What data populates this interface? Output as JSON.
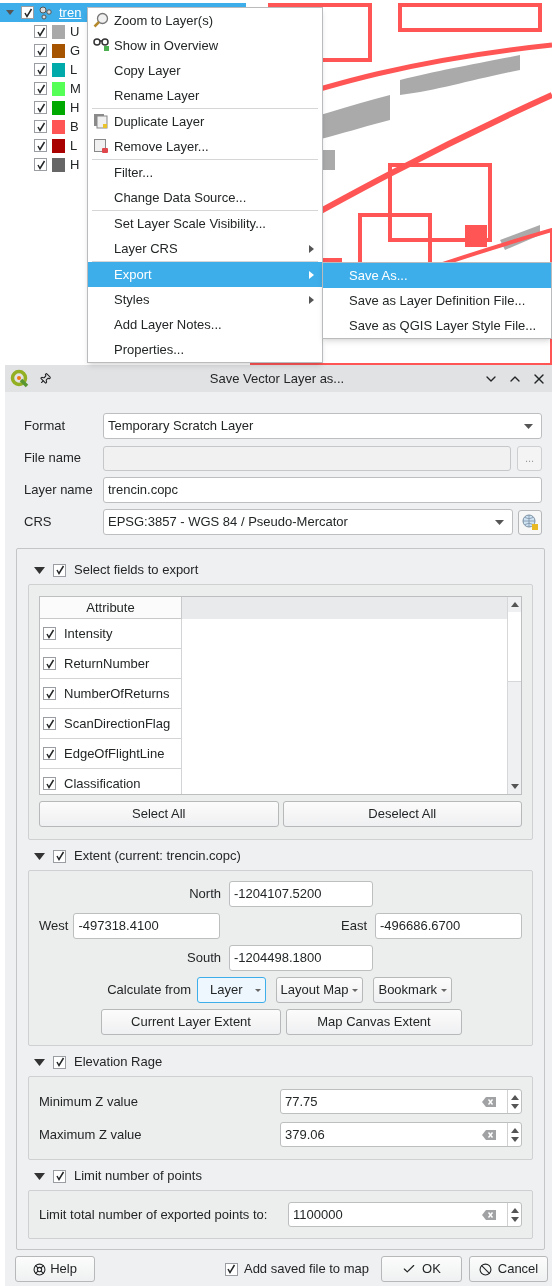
{
  "layer_tree": {
    "group": {
      "name": "tren",
      "checked": true,
      "expanded": true,
      "selected": true
    },
    "children": [
      {
        "label": "U",
        "checked": true,
        "color": "#a9a9a9"
      },
      {
        "label": "G",
        "checked": true,
        "color": "#a65400"
      },
      {
        "label": "L",
        "checked": true,
        "color": "#00a9aa"
      },
      {
        "label": "M",
        "checked": true,
        "color": "#55ff55"
      },
      {
        "label": "H",
        "checked": true,
        "color": "#00a900"
      },
      {
        "label": "B",
        "checked": true,
        "color": "#ff5555"
      },
      {
        "label": "L",
        "checked": true,
        "color": "#a90000"
      },
      {
        "label": "H",
        "checked": true,
        "color": "#666666"
      }
    ]
  },
  "context_menu": {
    "sections": [
      [
        {
          "label": "Zoom to Layer(s)",
          "selected": false,
          "submenu": false
        },
        {
          "label": "Show in Overview",
          "selected": false,
          "submenu": false
        },
        {
          "label": "Copy Layer",
          "selected": false,
          "submenu": false
        },
        {
          "label": "Rename Layer",
          "selected": false,
          "submenu": false
        }
      ],
      [
        {
          "label": "Duplicate Layer",
          "selected": false,
          "submenu": false
        },
        {
          "label": "Remove Layer...",
          "selected": false,
          "submenu": false
        }
      ],
      [
        {
          "label": "Filter...",
          "selected": false,
          "submenu": false
        },
        {
          "label": "Change Data Source...",
          "selected": false,
          "submenu": false
        }
      ],
      [
        {
          "label": "Set Layer Scale Visibility...",
          "selected": false,
          "submenu": false
        },
        {
          "label": "Layer CRS",
          "selected": false,
          "submenu": true
        }
      ],
      [
        {
          "label": "Export",
          "selected": true,
          "submenu": true
        },
        {
          "label": "Styles",
          "selected": false,
          "submenu": true
        },
        {
          "label": "Add Layer Notes...",
          "selected": false,
          "submenu": false
        },
        {
          "label": "Properties...",
          "selected": false,
          "submenu": false
        }
      ]
    ]
  },
  "submenu": {
    "items": [
      {
        "label": "Save As...",
        "selected": true
      },
      {
        "label": "Save as Layer Definition File...",
        "selected": false
      },
      {
        "label": "Save as QGIS Layer Style File...",
        "selected": false
      }
    ]
  },
  "dialog": {
    "title": "Save Vector Layer as...",
    "form": {
      "format": {
        "label": "Format",
        "value": "Temporary Scratch Layer"
      },
      "file_name": {
        "label": "File name",
        "disabled": true,
        "browse": "..."
      },
      "layer_name": {
        "label": "Layer name",
        "value": "trencin.copc"
      },
      "crs": {
        "label": "CRS",
        "value": "EPSG:3857 - WGS 84 / Pseudo-Mercator"
      }
    },
    "sections": [
      {
        "kind": "fields",
        "title": "Select fields to export",
        "checked": true,
        "expanded": true,
        "column": "Attribute",
        "rows": [
          {
            "label": "Intensity",
            "checked": true
          },
          {
            "label": "ReturnNumber",
            "checked": true
          },
          {
            "label": "NumberOfReturns",
            "checked": true
          },
          {
            "label": "ScanDirectionFlag",
            "checked": true
          },
          {
            "label": "EdgeOfFlightLine",
            "checked": true
          },
          {
            "label": "Classification",
            "checked": true
          }
        ],
        "buttons": [
          "Select All",
          "Deselect All"
        ]
      },
      {
        "kind": "extent",
        "title": "Extent (current: trencin.copc)",
        "checked": true,
        "expanded": true,
        "north": {
          "label": "North",
          "value": "-1204107.5200"
        },
        "west": {
          "label": "West",
          "value": "-497318.4100"
        },
        "east": {
          "label": "East",
          "value": "-496686.6700"
        },
        "south": {
          "label": "South",
          "value": "-1204498.1800"
        },
        "calculate_from": {
          "label": "Calculate from",
          "options": [
            {
              "label": "Layer",
              "focused": true
            },
            {
              "label": "Layout Map",
              "focused": false
            },
            {
              "label": "Bookmark",
              "focused": false
            }
          ]
        },
        "buttons": [
          "Current Layer Extent",
          "Map Canvas Extent"
        ]
      },
      {
        "kind": "values",
        "title": "Elevation Rage",
        "checked": true,
        "expanded": true,
        "rows": [
          {
            "label": "Minimum Z value",
            "value": "77.75"
          },
          {
            "label": "Maximum Z value",
            "value": "379.06"
          }
        ]
      },
      {
        "kind": "values",
        "title": "Limit number of points",
        "checked": true,
        "expanded": true,
        "rows": [
          {
            "label": "Limit total number of exported points to:",
            "value": "1100000"
          }
        ]
      }
    ],
    "footer": {
      "help": "Help",
      "add_to_map": {
        "label": "Add saved file to map",
        "checked": true
      },
      "ok": "OK",
      "cancel": "Cancel"
    }
  }
}
